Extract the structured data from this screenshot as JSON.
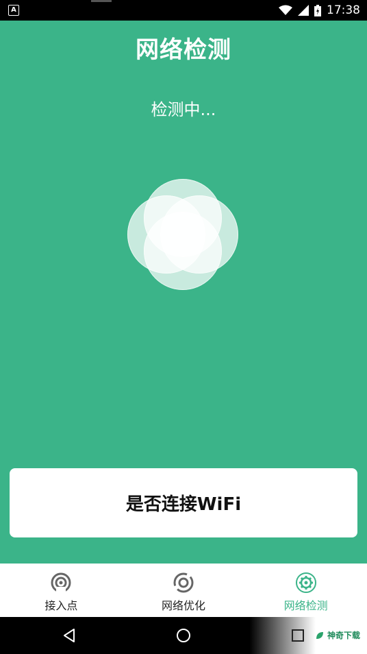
{
  "status_bar": {
    "notification_icon": "A",
    "time": "17:38"
  },
  "header": {
    "title": "网络检测"
  },
  "main": {
    "status_text": "检测中..."
  },
  "card": {
    "label": "是否连接WiFi"
  },
  "bottom_nav": {
    "items": [
      {
        "label": "接入点",
        "icon": "access-point-icon",
        "active": false
      },
      {
        "label": "网络优化",
        "icon": "optimize-icon",
        "active": false
      },
      {
        "label": "网络检测",
        "icon": "network-check-gear-icon",
        "active": true
      }
    ]
  },
  "watermark": {
    "text": "神奇下载"
  },
  "colors": {
    "primary": "#3bb489",
    "background": "#3bb489",
    "card": "#ffffff"
  }
}
